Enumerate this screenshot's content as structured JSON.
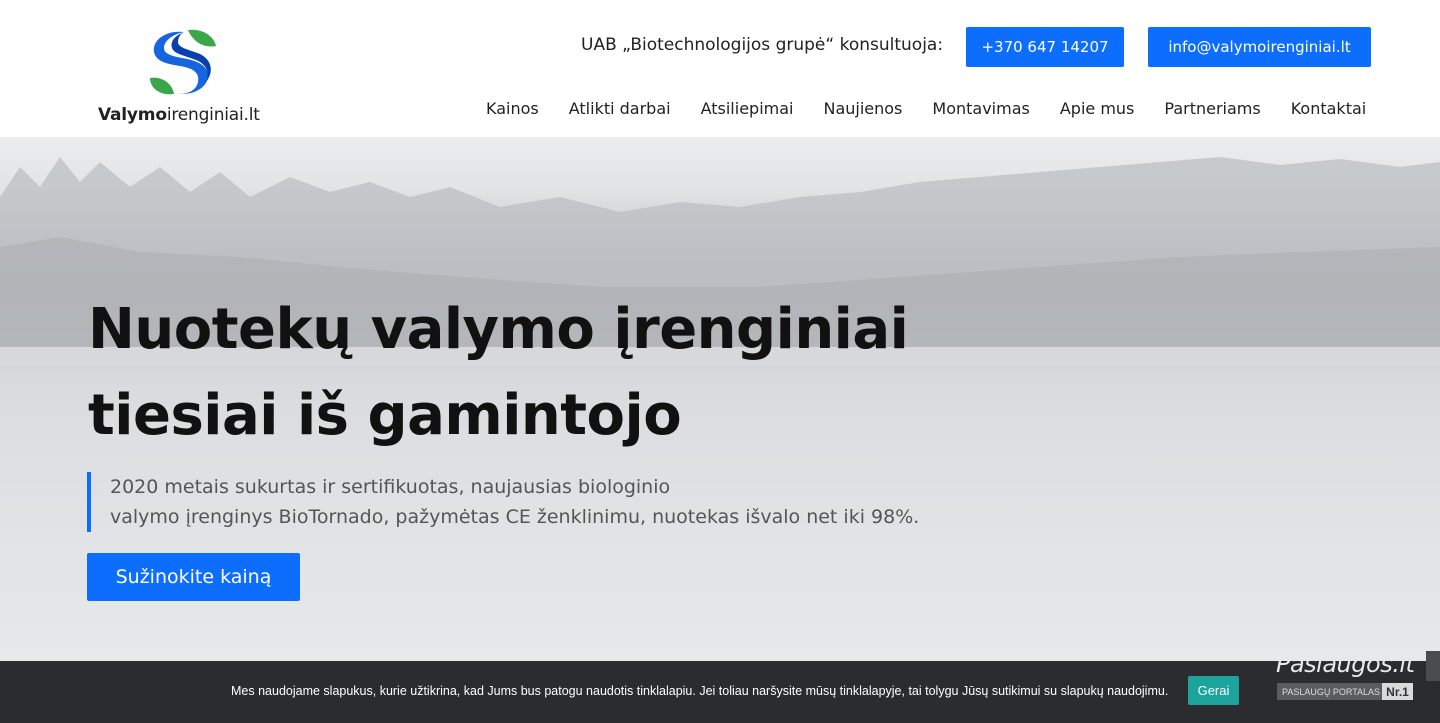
{
  "logo": {
    "brand_bold": "Valymo",
    "brand_light": "irenginiai.lt"
  },
  "header": {
    "consult_text": "UAB „Biotechnologijos grupė“ konsultuoja:",
    "phone_label": "+370 647 14207",
    "email_label": "info@valymoirenginiai.lt"
  },
  "nav": {
    "items": [
      {
        "label": "Kainos"
      },
      {
        "label": "Atlikti darbai"
      },
      {
        "label": "Atsiliepimai"
      },
      {
        "label": "Naujienos"
      },
      {
        "label": "Montavimas"
      },
      {
        "label": "Apie mus"
      },
      {
        "label": "Partneriams"
      },
      {
        "label": "Kontaktai"
      }
    ]
  },
  "hero": {
    "title_line1": "Nuotekų valymo įrenginiai",
    "title_line2": "tiesiai iš gamintojo",
    "desc_line1": "2020 metais sukurtas ir sertifikuotas, naujausias biologinio",
    "desc_line2": "valymo įrenginys BioTornado, pažymėtas CE ženklinimu, nuotekas išvalo net iki 98%.",
    "cta_label": "Sužinokite kainą"
  },
  "cookie": {
    "text": "Mes naudojame slapukus, kurie užtikrina, kad Jums bus patogu naudotis tinklalapiu. Jei toliau naršysite mūsų tinklalapyje, tai tolygu Jūsų sutikimui su slapukų naudojimu.",
    "accept_label": "Gerai"
  },
  "badge": {
    "title": "Paslaugos.lt",
    "subtitle": "PASLAUGŲ PORTALAS",
    "rank": "Nr.1"
  },
  "colors": {
    "accent": "#0d6efd",
    "cookie_bg": "#2a2c30",
    "cookie_btn": "#1ba39c"
  }
}
